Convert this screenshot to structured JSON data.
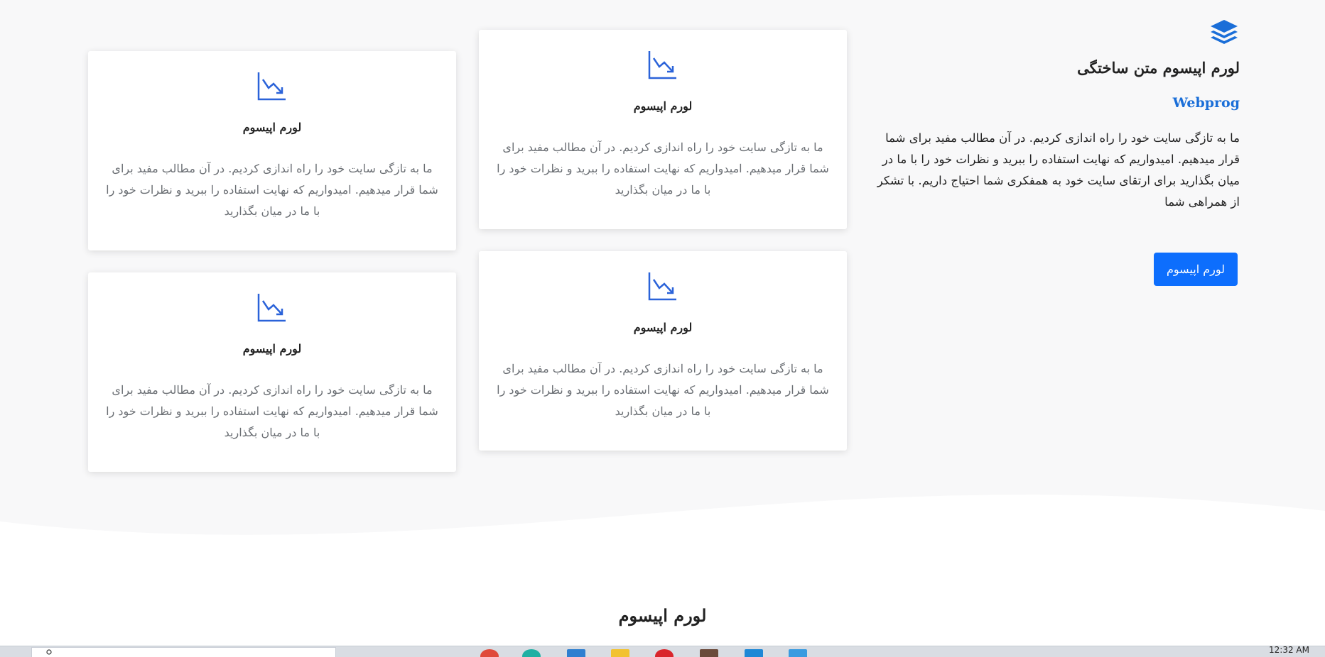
{
  "intro": {
    "icon": "layers-icon",
    "title": "لورم اپیسوم متن ساختگی",
    "brand": "Webprog",
    "text": "ما به تازگی سایت خود را راه اندازی کردیم. در آن مطالب مفید برای شما قرار میدهیم. امیدواریم که نهایت استفاده را ببرید و نظرات خود را با ما در میان بگذارید برای ارتقای سایت خود به همفکری شما احتیاج داریم. با تشکر از همراهی شما",
    "button_label": "لورم اپیسوم"
  },
  "cards": [
    {
      "icon": "chart-down-icon",
      "title": "لورم اپیسوم",
      "text": "ما به تازگی سایت خود را راه اندازی کردیم. در آن مطالب مفید برای شما قرار میدهیم. امیدواریم که نهایت استفاده را ببرید و نظرات خود را با ما در میان بگذارید"
    },
    {
      "icon": "chart-down-icon",
      "title": "لورم اپیسوم",
      "text": "ما به تازگی سایت خود را راه اندازی کردیم. در آن مطالب مفید برای شما قرار میدهیم. امیدواریم که نهایت استفاده را ببرید و نظرات خود را با ما در میان بگذارید"
    },
    {
      "icon": "chart-down-icon",
      "title": "لورم اپیسوم",
      "text": "ما به تازگی سایت خود را راه اندازی کردیم. در آن مطالب مفید برای شما قرار میدهیم. امیدواریم که نهایت استفاده را ببرید و نظرات خود را با ما در میان بگذارید"
    },
    {
      "icon": "chart-down-icon",
      "title": "لورم اپیسوم",
      "text": "ما به تازگی سایت خود را راه اندازی کردیم. در آن مطالب مفید برای شما قرار میدهیم. امیدواریم که نهایت استفاده را ببرید و نظرات خود را با ما در میان بگذارید"
    }
  ],
  "bottom_heading": "لورم اپیسوم",
  "taskbar": {
    "clock": "12:32 AM",
    "apps": [
      "chrome-icon",
      "edge-icon",
      "folder-icon",
      "store-icon",
      "opera-icon",
      "app-icon",
      "vscode-icon",
      "mail-icon"
    ]
  },
  "colors": {
    "accent": "#0d6efd",
    "brand_text": "#1a6ed8",
    "icon_blue": "#2b63d9",
    "section_bg": "#f8f8f9",
    "muted_text": "#6b6f74"
  }
}
